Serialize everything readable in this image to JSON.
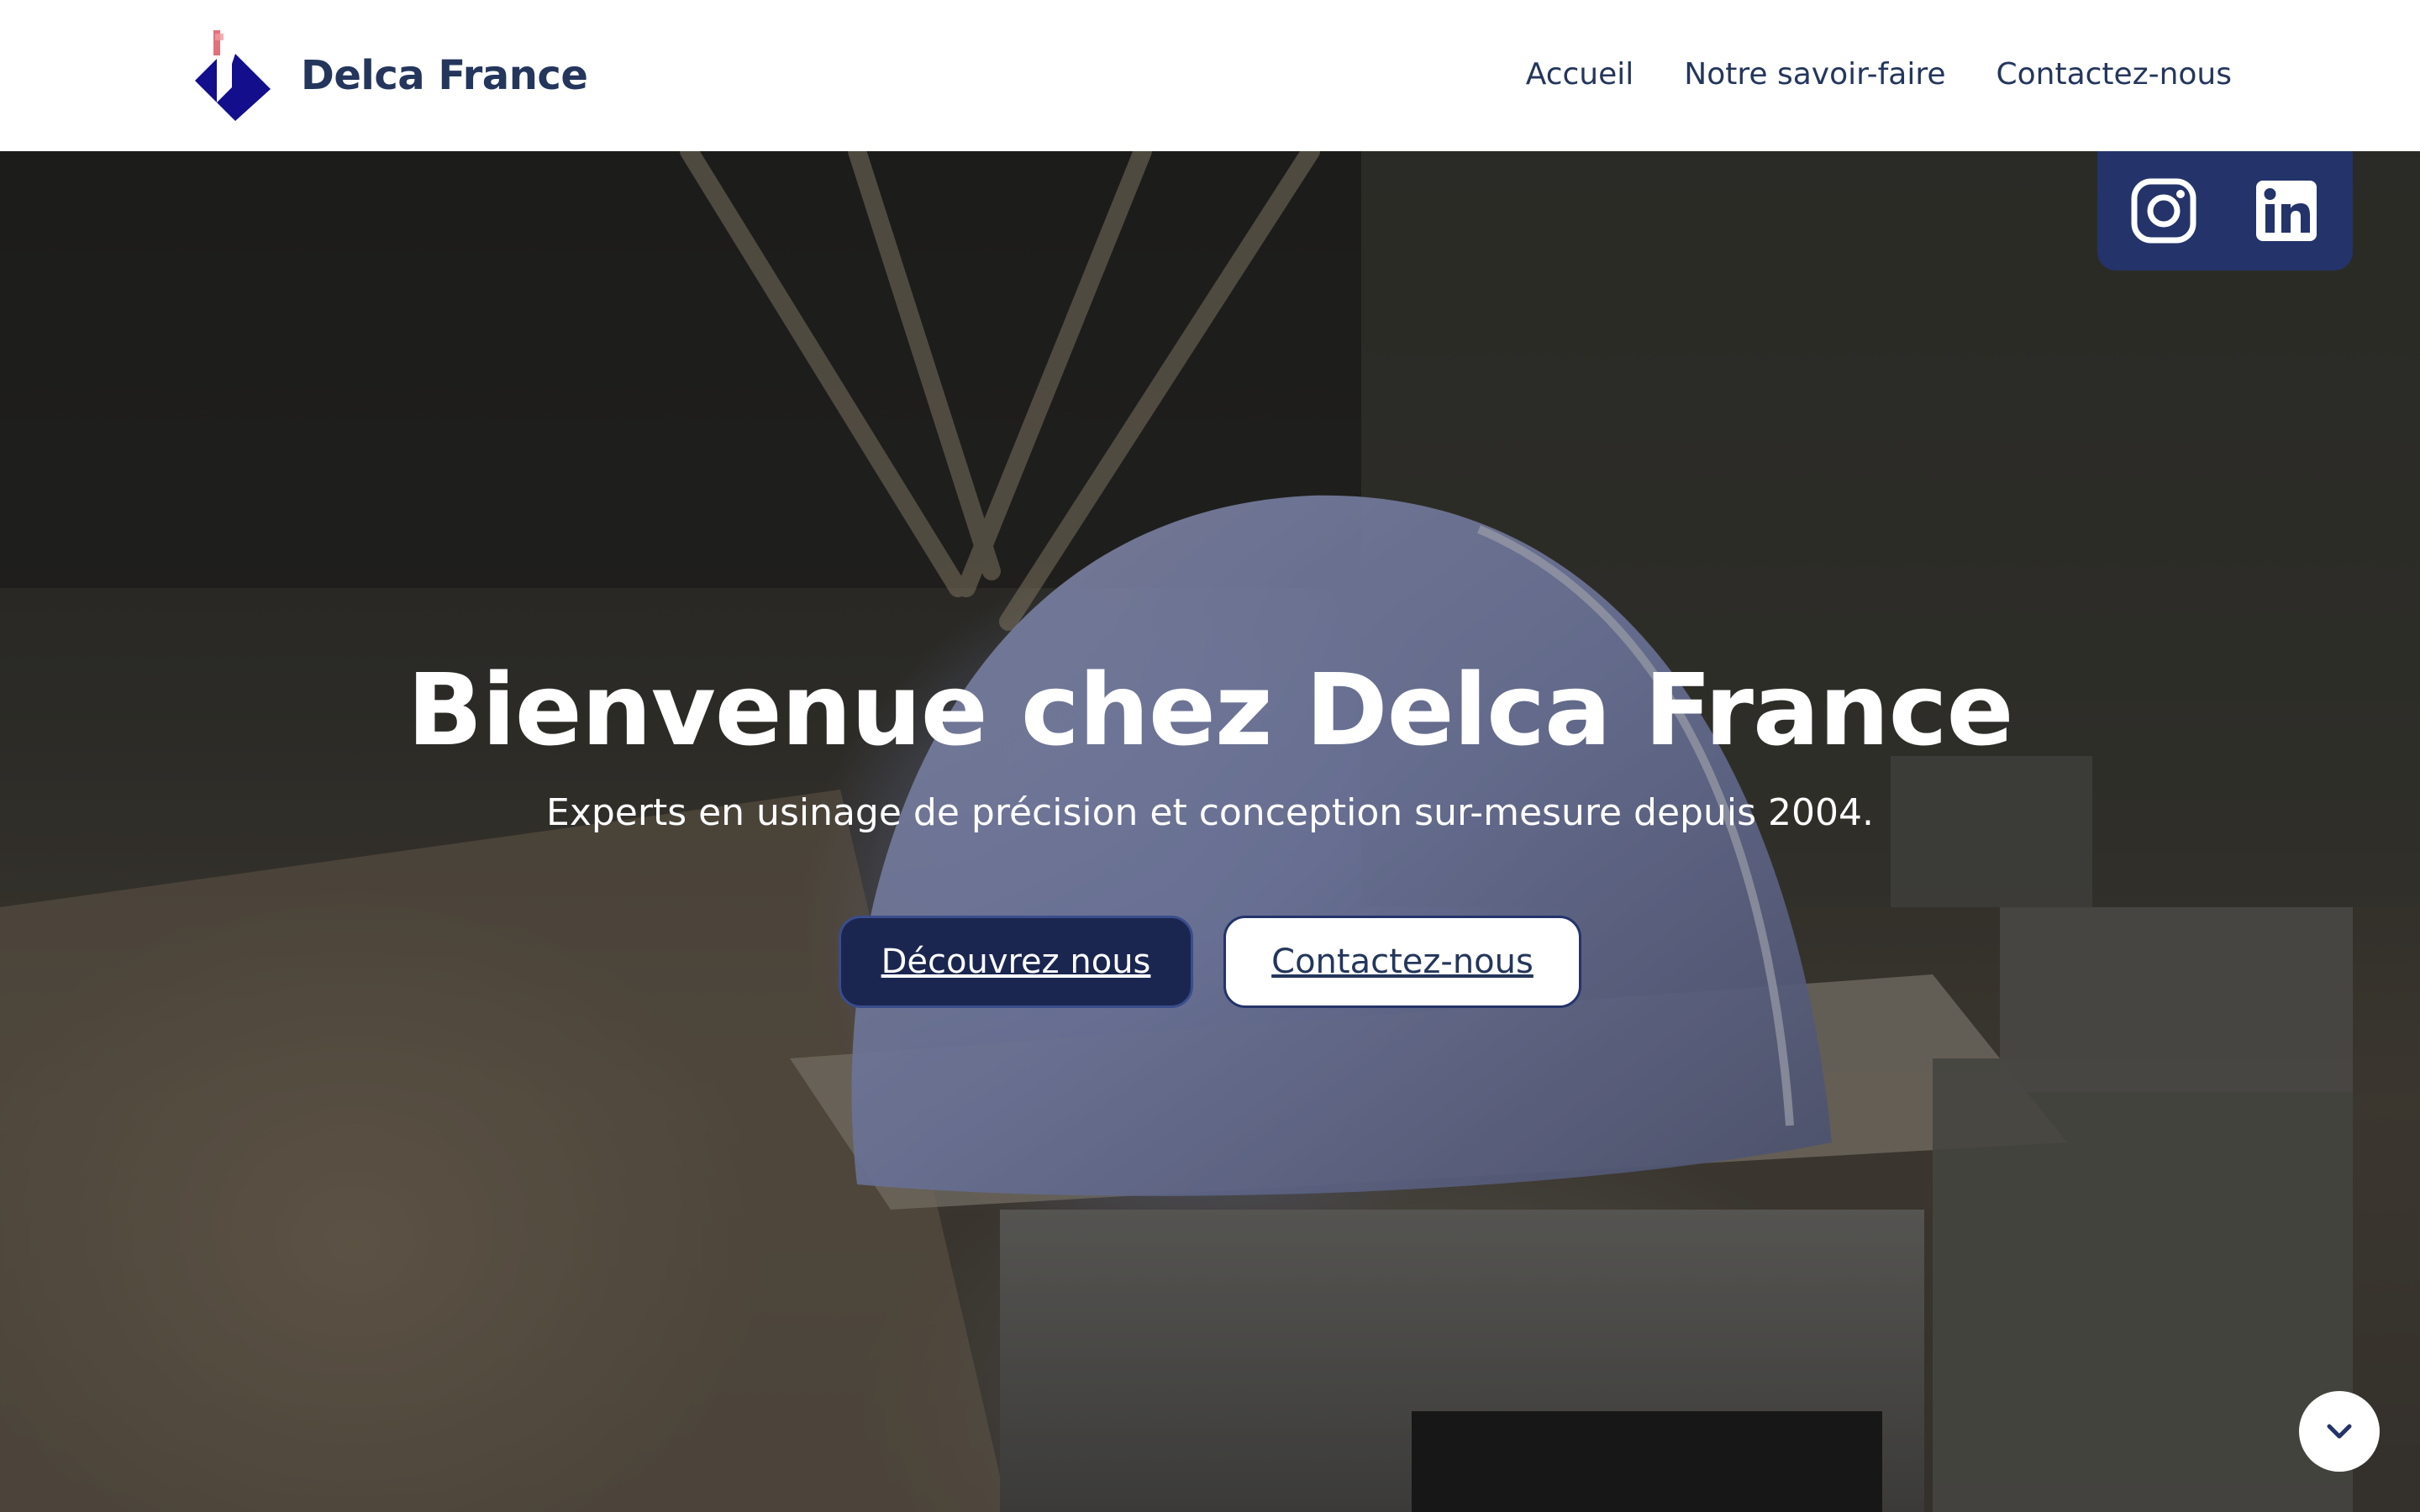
{
  "header": {
    "brand": "Delca France",
    "logo_icon": "delca-diamond-logo",
    "nav": [
      {
        "label": "Accueil"
      },
      {
        "label": "Notre savoir-faire"
      },
      {
        "label": "Contactez-nous"
      }
    ]
  },
  "social": {
    "items": [
      {
        "icon": "instagram-icon"
      },
      {
        "icon": "linkedin-icon"
      }
    ],
    "background": "#24336a"
  },
  "hero": {
    "title": "Bienvenue chez Delca France",
    "subtitle": "Experts en usinage de précision et conception sur-mesure depuis 2004.",
    "primary_button": "Découvrez nous",
    "secondary_button": "Contactez-nous",
    "scroll_icon": "chevron-down-icon"
  },
  "colors": {
    "brand_navy": "#24365c",
    "button_primary": "#1b2650",
    "logo_blue": "#120e8c",
    "logo_accent": "#e0606a"
  }
}
